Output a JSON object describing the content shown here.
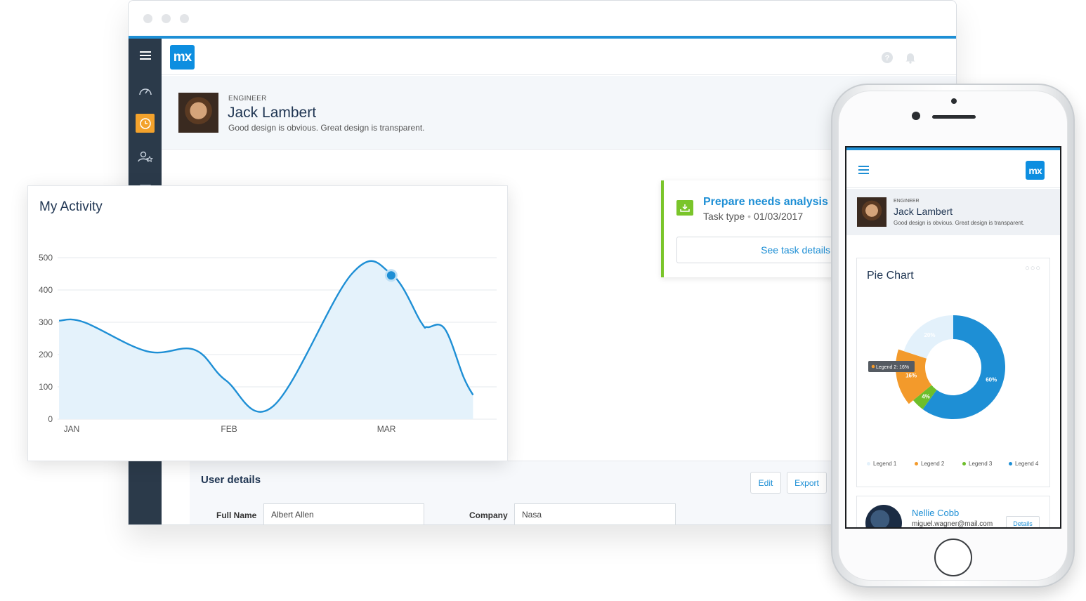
{
  "app": {
    "logo_text": "mx",
    "sidebar_items": [
      "menu-icon",
      "dashboard-icon",
      "clock-icon",
      "users-star-icon",
      "calendar-icon"
    ],
    "colors": {
      "accent": "#1e8fd5",
      "sidebar": "#2b3a4a",
      "active": "#f3a22c",
      "success": "#7ac52a",
      "brand": "#0d8ee0"
    }
  },
  "profile": {
    "role": "ENGINEER",
    "name": "Jack Lambert",
    "tagline": "Good design is obvious. Great design is transparent."
  },
  "task": {
    "title": "Prepare needs analysis d",
    "type": "Task type",
    "separator": "•",
    "date": "01/03/2017",
    "button": "See task details"
  },
  "user_details": {
    "title": "User details",
    "edit_label": "Edit",
    "export_label": "Export",
    "full_name_label": "Full Name",
    "full_name_value": "Albert Allen",
    "company_label": "Company",
    "company_value": "Nasa"
  },
  "activity": {
    "title": "My Activity"
  },
  "chart_data": [
    {
      "type": "area",
      "title": "My Activity",
      "xlabel": "",
      "ylabel": "",
      "ylim": [
        0,
        500
      ],
      "yticks": [
        0,
        100,
        200,
        300,
        400,
        500
      ],
      "xtick_labels": [
        {
          "label": "JAN",
          "x": 0
        },
        {
          "label": "FEB",
          "x": 1
        },
        {
          "label": "MAR",
          "x": 2
        }
      ],
      "x": [
        -0.08,
        0.08,
        0.48,
        0.78,
        0.98,
        1.28,
        1.78,
        2.03,
        2.22,
        2.26,
        2.37,
        2.49,
        2.55
      ],
      "values": [
        305,
        300,
        210,
        215,
        120,
        40,
        450,
        450,
        300,
        285,
        280,
        130,
        75
      ],
      "highlight": {
        "x": 2.03,
        "value": 445
      },
      "grid": true,
      "color": "#1e8fd5"
    },
    {
      "type": "pie",
      "title": "Pie Chart",
      "donut": true,
      "labels": [
        "Legend 1",
        "Legend 2",
        "Legend 3",
        "Legend 4"
      ],
      "values": [
        20,
        16,
        4,
        60
      ],
      "slice_labels": [
        "20%",
        "16%",
        "4%",
        "60%"
      ],
      "colors": [
        "#e3f1fb",
        "#f39a2b",
        "#6dbe2b",
        "#1e8fd5"
      ],
      "tooltip": "Legend 2: 16%",
      "legend_position": "bottom"
    }
  ],
  "mobile": {
    "logo_text": "mx",
    "menu_icon": "menu-icon",
    "pie_title": "Pie Chart",
    "more": "○○○",
    "contact": {
      "name": "Nellie Cobb",
      "email": "miguel.wagner@mail.com",
      "button": "Details"
    }
  }
}
